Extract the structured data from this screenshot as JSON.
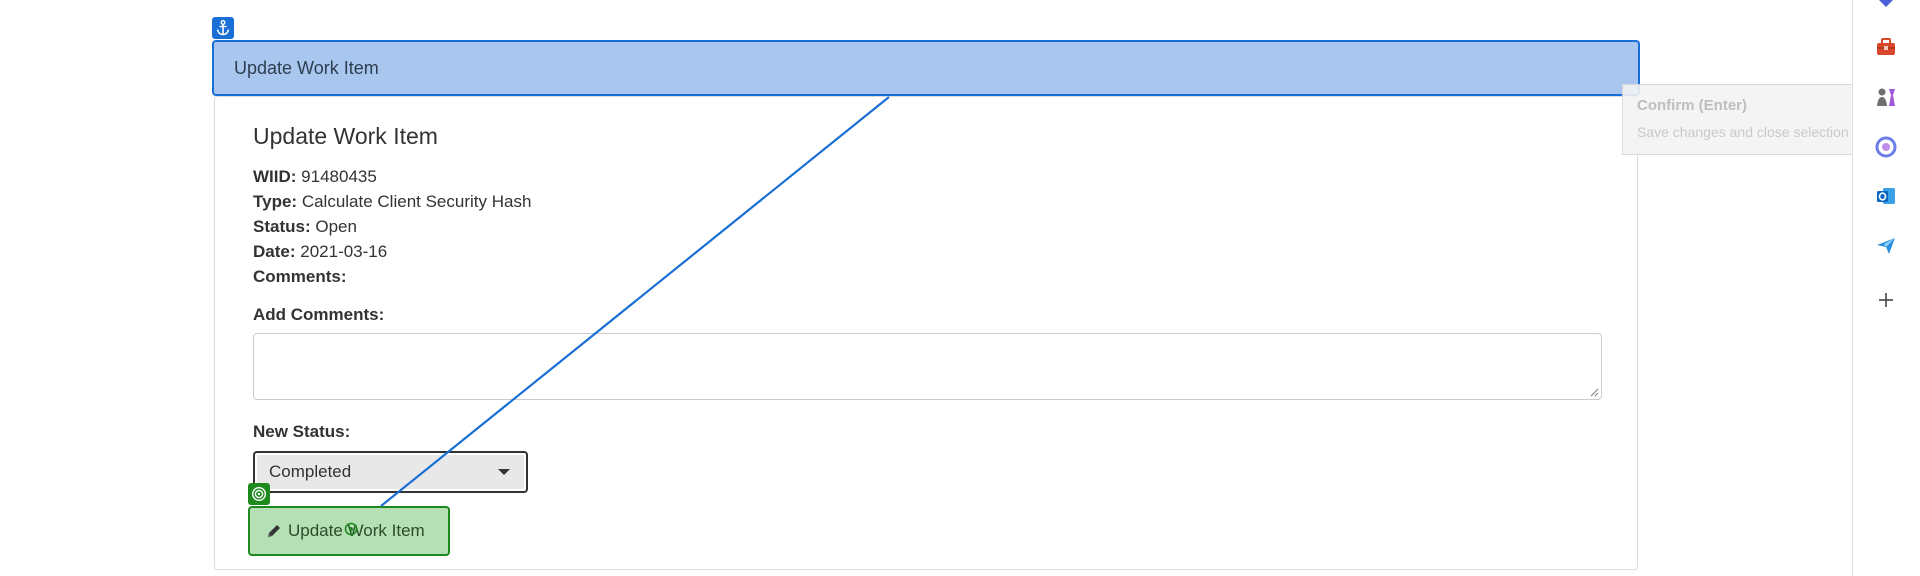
{
  "header": {
    "title": "Update Work Item"
  },
  "panel": {
    "title": "Update Work Item",
    "fields": [
      {
        "label": "WIID:",
        "value": "91480435"
      },
      {
        "label": "Type:",
        "value": "Calculate Client Security Hash"
      },
      {
        "label": "Status:",
        "value": "Open"
      },
      {
        "label": "Date:",
        "value": "2021-03-16"
      },
      {
        "label": "Comments:",
        "value": ""
      }
    ],
    "add_comments_label": "Add Comments:",
    "comments_value": "",
    "new_status_label": "New Status:",
    "new_status_value": "Completed",
    "update_button_label": "Update Work Item"
  },
  "tooltip": {
    "title": "Confirm (Enter)",
    "description": "Save changes and close selection wizard."
  },
  "sidebar": {
    "icons": [
      "diamond-icon",
      "toolbox-icon",
      "chess-pieces-icon",
      "copilot-icon",
      "outlook-icon",
      "send-icon",
      "add-icon"
    ]
  },
  "colors": {
    "anchor_blue": "#1a6fd6",
    "anchor_fill": "#a9c7ee",
    "target_green": "#1e8a1e",
    "target_fill": "#b5e0b5"
  }
}
